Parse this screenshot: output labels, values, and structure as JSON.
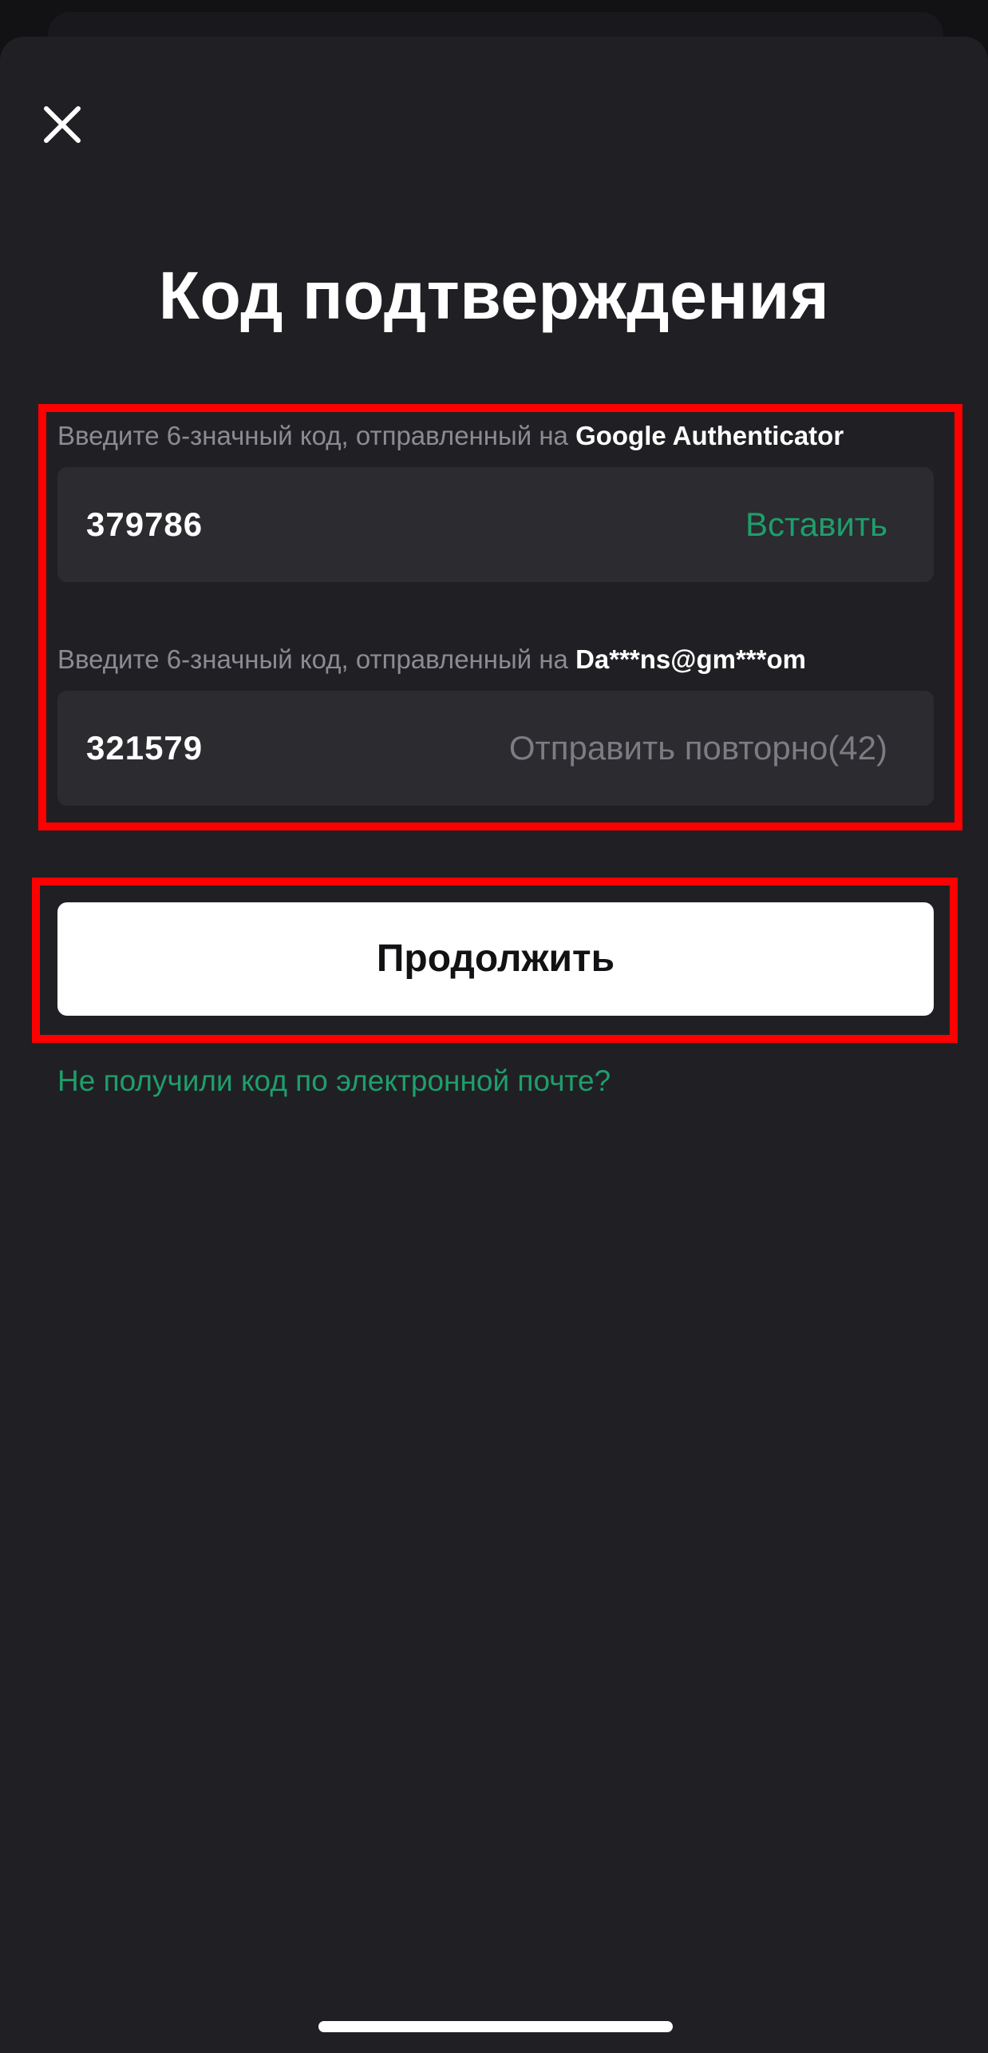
{
  "icons": {
    "close": "close-icon"
  },
  "header": {
    "title": "Код подтверждения"
  },
  "form": {
    "authenticator": {
      "label_prefix": "Введите 6-значный код, отправленный на ",
      "label_target": "Google Authenticator",
      "value": "379786",
      "action": "Вставить"
    },
    "email": {
      "label_prefix": "Введите 6-значный код, отправленный на ",
      "label_target": "Da***ns@gm***om",
      "value": "321579",
      "action": "Отправить повторно(42)"
    },
    "continue_label": "Продолжить",
    "help_link": "Не получили код по электронной почте?"
  },
  "colors": {
    "background": "#202024",
    "field": "#2b2b30",
    "accent_green": "#1f9e6b",
    "highlight": "#ff0000",
    "button": "#ffffff"
  }
}
